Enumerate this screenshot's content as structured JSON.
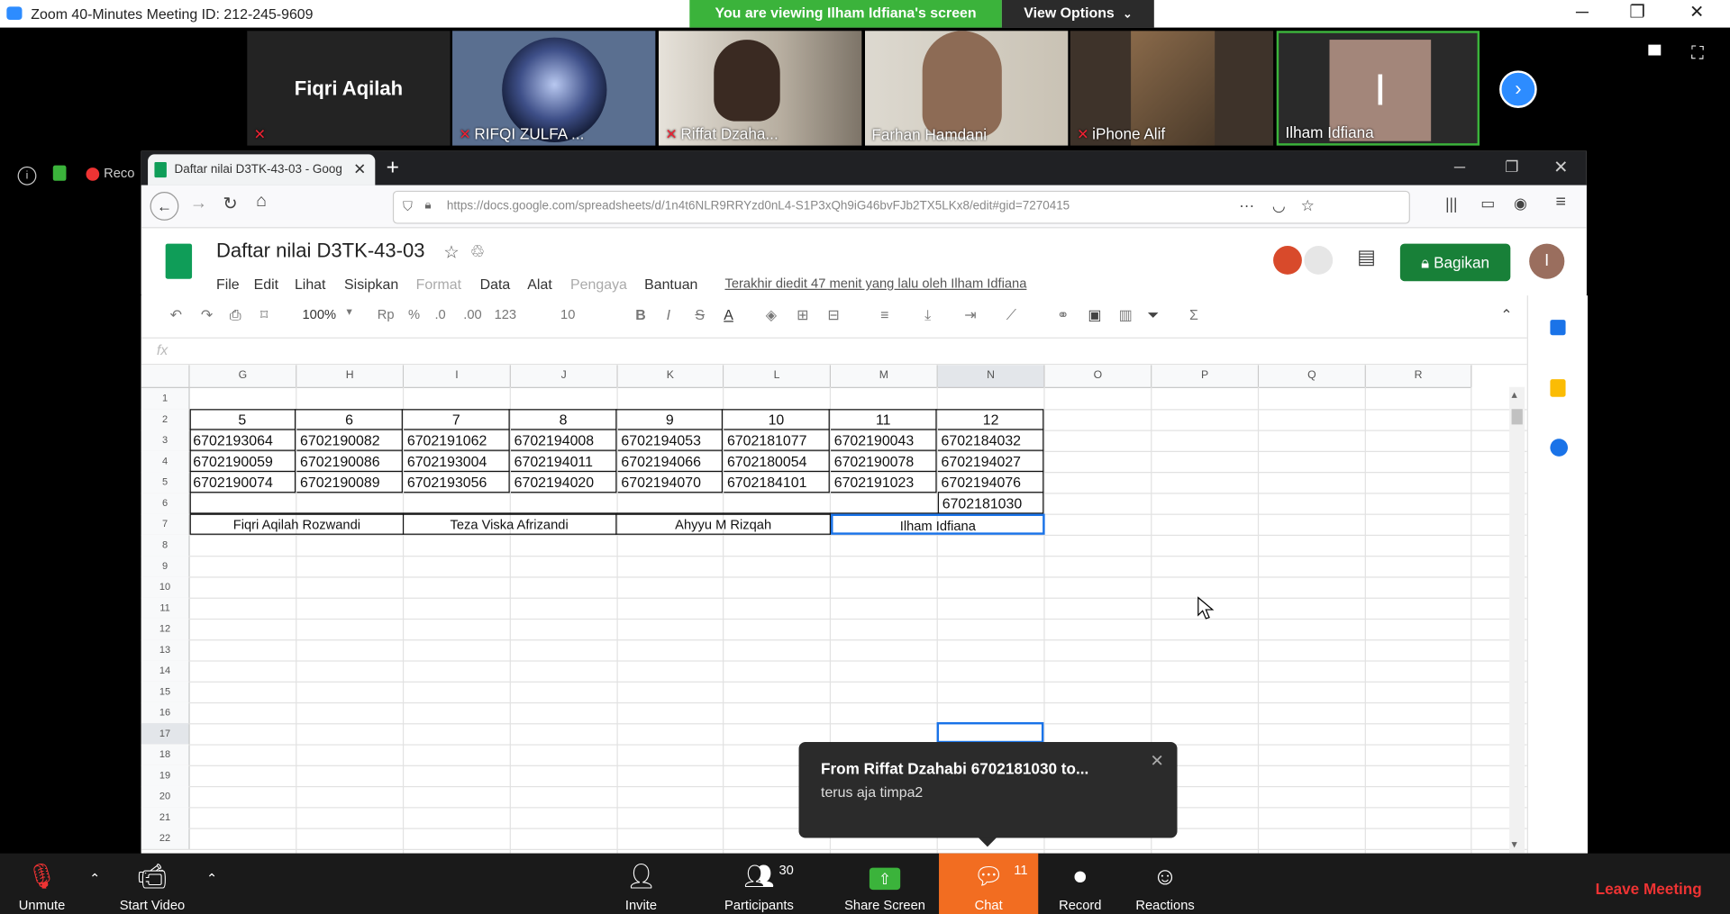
{
  "app": {
    "window_title": "Zoom 40-Minutes Meeting ID: 212-245-9609",
    "viewing_banner": "You are viewing Ilham Idfiana's screen",
    "view_options": "View Options",
    "minimize": "─",
    "restore": "❐",
    "close": "✕"
  },
  "gallery": {
    "tiles": [
      {
        "name": "Fiqri Aqilah",
        "big_name": "Fiqri Aqilah"
      },
      {
        "name": "RIFQI ZULFA ..."
      },
      {
        "name": "Riffat Dzaha..."
      },
      {
        "name": "Farhan Hamdani"
      },
      {
        "name": "iPhone Alif"
      },
      {
        "name": "Ilham Idfiana"
      }
    ],
    "recording_label": "Reco"
  },
  "browser": {
    "tab_title": "Daftar nilai D3TK-43-03 - Goog",
    "url": "https://docs.google.com/spreadsheets/d/1n4t6NLR9RRYzd0nL4-S1P3xQh9iG46bvFJb2TX5LKx8/edit#gid=7270415"
  },
  "sheets": {
    "doc_title": "Daftar nilai D3TK-43-03",
    "menus": [
      "File",
      "Edit",
      "Lihat",
      "Sisipkan",
      "Format",
      "Data",
      "Alat",
      "Pengaya",
      "Bantuan"
    ],
    "last_edit": "Terakhir diedit 47 menit yang lalu oleh Ilham Idfiana",
    "share_label": "Bagikan",
    "avatar_letter": "I",
    "zoom": "100%",
    "currency": "Rp",
    "percent": "%",
    "dec_less": ".0",
    "dec_more": ".00",
    "format_more": "123",
    "font_size": "10",
    "fx": "fx",
    "columns": [
      "G",
      "H",
      "I",
      "J",
      "K",
      "L",
      "M",
      "N",
      "O",
      "P",
      "Q",
      "R"
    ],
    "rows": [
      "1",
      "2",
      "3",
      "4",
      "5",
      "6",
      "7",
      "8",
      "9",
      "10",
      "11",
      "12",
      "13",
      "14",
      "15",
      "16",
      "17",
      "18",
      "19",
      "20",
      "21",
      "22"
    ],
    "header_numbers": [
      "5",
      "6",
      "7",
      "8",
      "9",
      "10",
      "11",
      "12"
    ],
    "row3": [
      "6702193064",
      "6702190082",
      "6702191062",
      "6702194008",
      "6702194053",
      "6702181077",
      "6702190043",
      "6702184032"
    ],
    "row4": [
      "6702190059",
      "6702190086",
      "6702193004",
      "6702194011",
      "6702194066",
      "6702180054",
      "6702190078",
      "6702194027"
    ],
    "row5": [
      "6702190074",
      "6702190089",
      "6702193056",
      "6702194020",
      "6702194070",
      "6702184101",
      "6702191023",
      "6702194076"
    ],
    "row6_n": "6702181030",
    "names": [
      "Fiqri Aqilah Rozwandi",
      "Teza Viska Afrizandi",
      "Ahyyu M Rizqah",
      "Ilham Idfiana"
    ]
  },
  "chat_popup": {
    "from": "From  Riffat Dzahabi 6702181030 to...",
    "message": "terus aja timpa2"
  },
  "bottombar": {
    "unmute": "Unmute",
    "start_video": "Start Video",
    "invite": "Invite",
    "participants": "Participants",
    "participants_count": "30",
    "share_screen": "Share Screen",
    "chat": "Chat",
    "chat_count": "11",
    "record": "Record",
    "reactions": "Reactions",
    "leave": "Leave Meeting"
  }
}
